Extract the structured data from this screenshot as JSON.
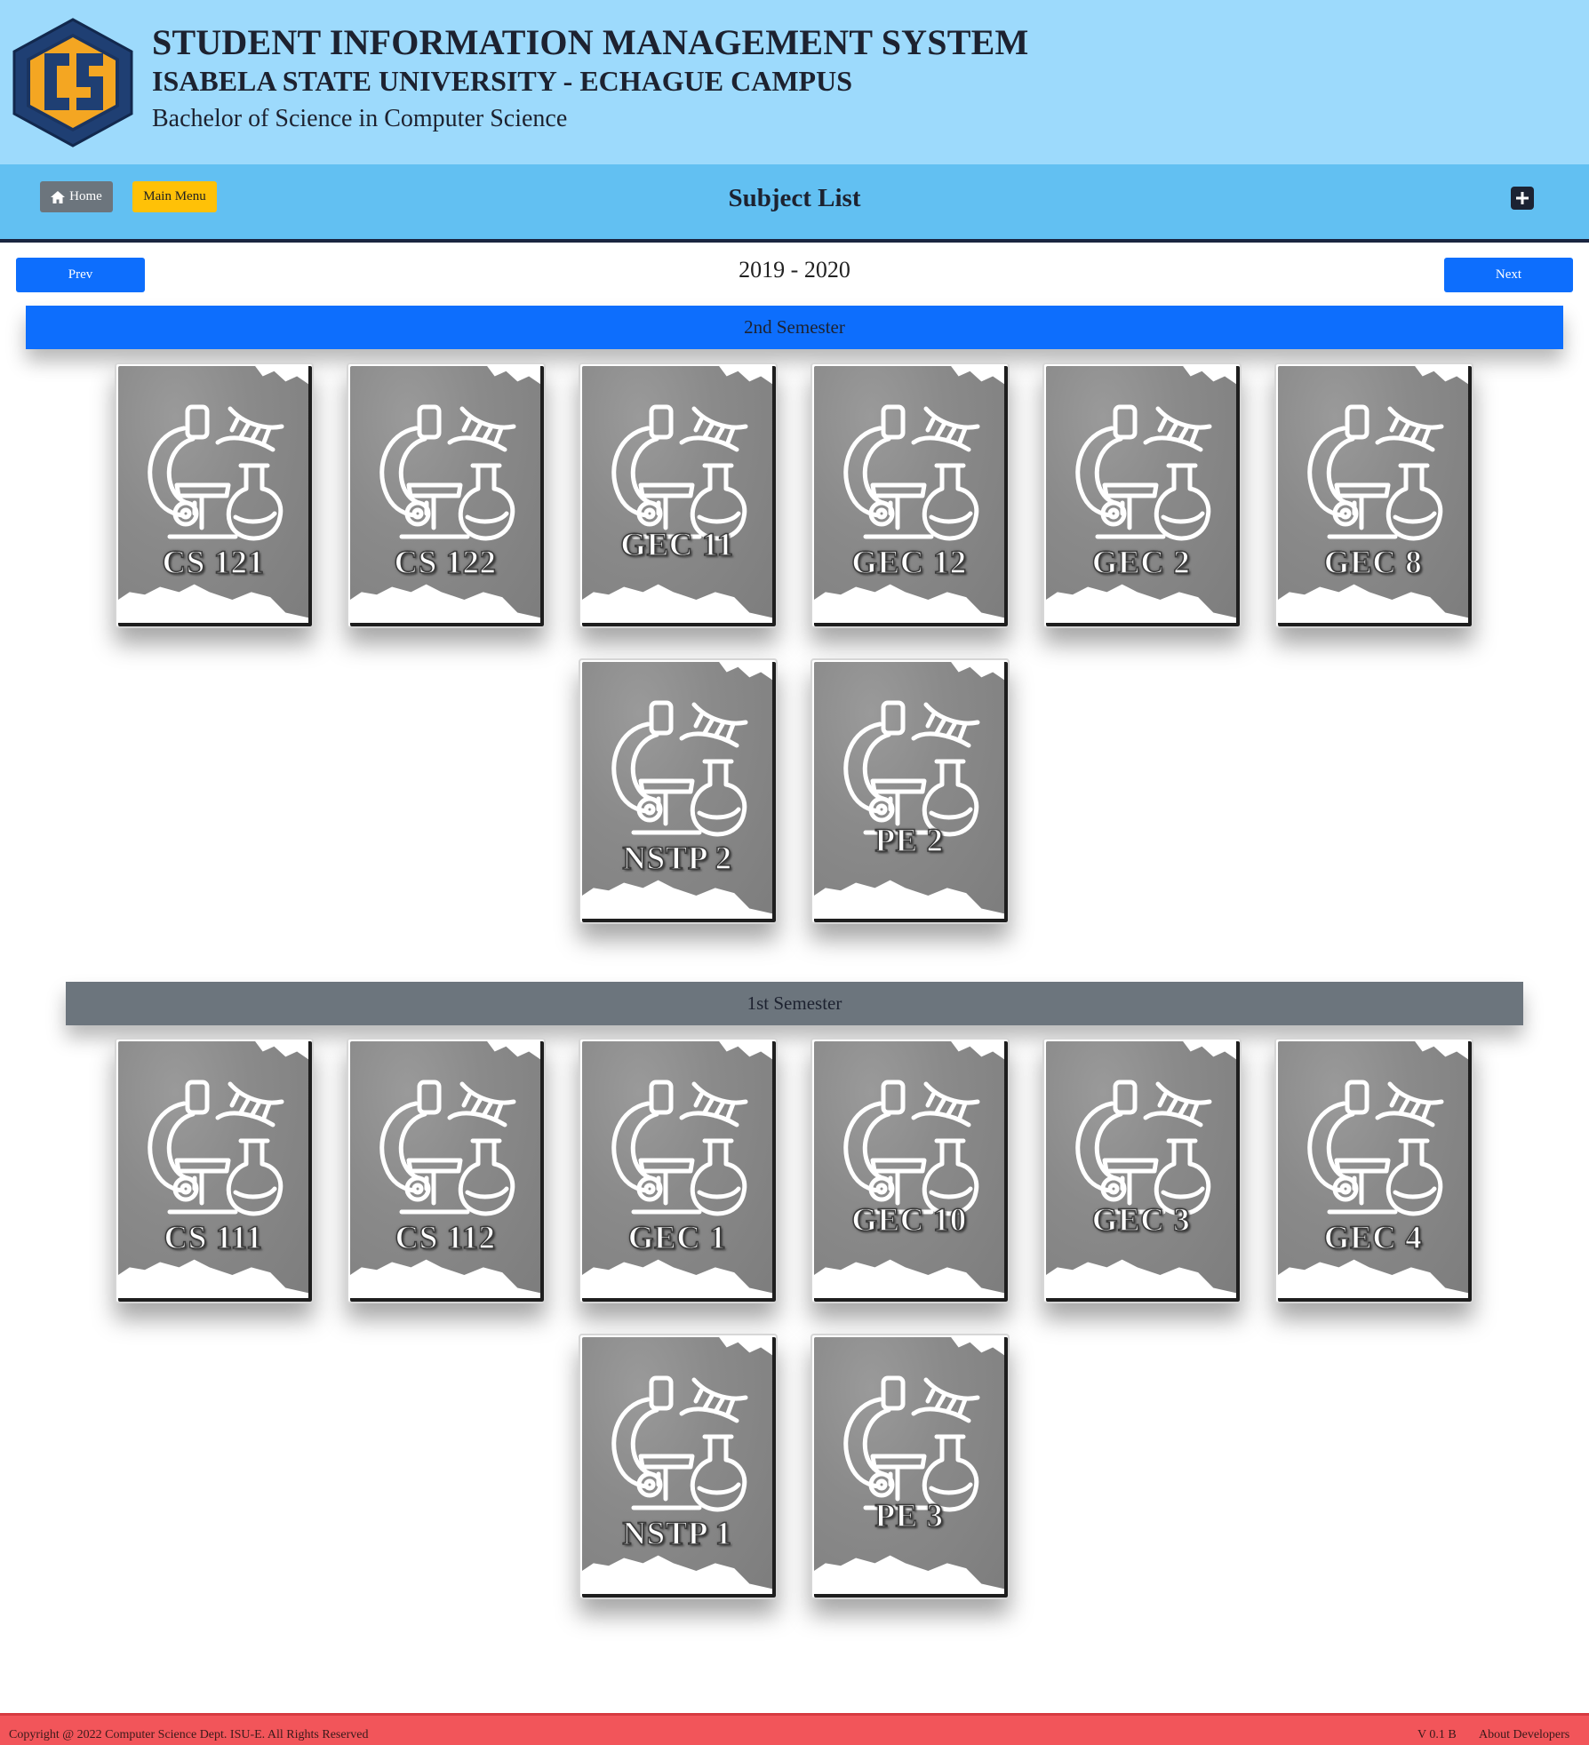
{
  "header": {
    "title": "STUDENT INFORMATION MANAGEMENT SYSTEM",
    "university": "ISABELA STATE UNIVERSITY - ECHAGUE CAMPUS",
    "program": "Bachelor of Science in Computer Science",
    "logo_icon": "cs-hexagon-logo-icon",
    "logo_text": "CS"
  },
  "nav": {
    "home_label": "Home",
    "main_menu_label": "Main Menu",
    "page_title": "Subject List",
    "add_icon": "plus-square-icon"
  },
  "year_nav": {
    "prev_label": "Prev",
    "year_label": "2019 - 2020",
    "next_label": "Next"
  },
  "semesters": [
    {
      "label": "2nd Semester",
      "color": "#0d6efd",
      "subjects": [
        "CS 121",
        "CS 122",
        "GEC 11",
        "GEC 12",
        "GEC 2",
        "GEC 8",
        "NSTP 2",
        "PE 2"
      ]
    },
    {
      "label": "1st Semester",
      "color": "#6c757d",
      "subjects": [
        "CS 111",
        "CS 112",
        "GEC 1",
        "GEC 10",
        "GEC 3",
        "GEC 4",
        "NSTP 1",
        "PE 3"
      ]
    }
  ],
  "card_icon": "science-lab-icon",
  "footer": {
    "copyright": "Copyright @ 2022 Computer Science Dept. ISU-E. All Rights Reserved",
    "version": "V 0.1 B",
    "about_label": "About Developers"
  },
  "colors": {
    "header_bg": "#9ddafc",
    "nav_bg": "#62c0f2",
    "primary": "#0d6efd",
    "secondary": "#6c757d",
    "warning": "#ffc107",
    "footer_bg": "#f2555a"
  }
}
